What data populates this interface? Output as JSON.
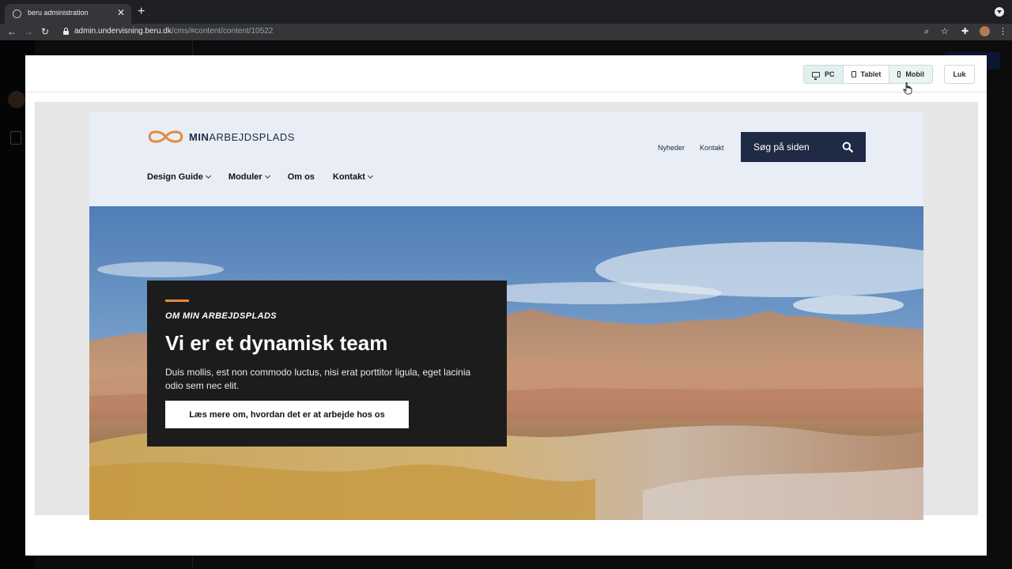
{
  "browser": {
    "tab_title": "beru administration",
    "tab_close": "✕",
    "new_tab": "+",
    "url_host": "admin.undervisning.beru.dk",
    "url_path": "/cms/#content/content/10522"
  },
  "preview": {
    "devices": [
      {
        "label": "PC",
        "icon": "monitor-icon",
        "state": "active"
      },
      {
        "label": "Tablet",
        "icon": "tablet-icon",
        "state": "normal"
      },
      {
        "label": "Mobil",
        "icon": "mobile-icon",
        "state": "hover"
      }
    ],
    "close_label": "Luk"
  },
  "site": {
    "logo_bold": "MIN",
    "logo_regular": "ARBEJDSPLADS",
    "util_links": [
      "Nyheder",
      "Kontakt"
    ],
    "search_label": "Søg på siden",
    "nav": [
      {
        "label": "Design Guide",
        "has_dropdown": true
      },
      {
        "label": "Moduler",
        "has_dropdown": true
      },
      {
        "label": "Om os",
        "has_dropdown": false
      },
      {
        "label": "Kontakt",
        "has_dropdown": true
      }
    ],
    "hero": {
      "eyebrow": "OM MIN ARBEJDSPLADS",
      "title": "Vi er et dynamisk team",
      "text": "Duis mollis, est non commodo luctus, nisi erat porttitor ligula, eget lacinia odio sem nec elit.",
      "button": "Læs mere om, hvordan det er at arbejde hos os"
    }
  },
  "colors": {
    "accent_orange": "#e5893a",
    "navy": "#1f2a44",
    "header_bg": "#e9edf5",
    "active_device": "#e1f0ed"
  }
}
